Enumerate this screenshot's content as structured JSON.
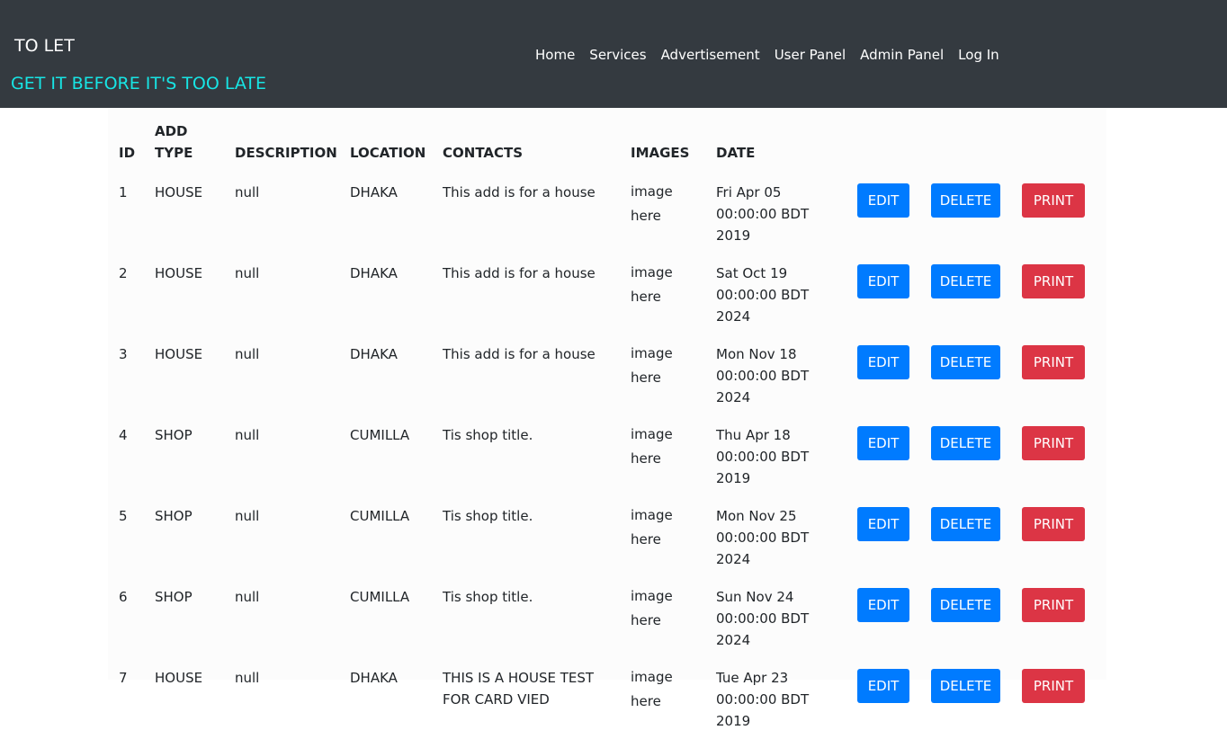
{
  "navbar": {
    "brand": "TO LET",
    "tagline": "GET IT BEFORE IT'S TOO LATE",
    "links": [
      "Home",
      "Services",
      "Advertisement",
      "User Panel",
      "Admin Panel",
      "Log In"
    ]
  },
  "table": {
    "headers": [
      "ID",
      "ADD TYPE",
      "DESCRIPTION",
      "LOCATION",
      "CONTACTS",
      "IMAGES",
      "DATE"
    ],
    "actions": {
      "edit": "EDIT",
      "delete": "DELETE",
      "print": "PRINT"
    },
    "rows": [
      {
        "id": "1",
        "type": "HOUSE",
        "description": "null",
        "location": "DHAKA",
        "contacts": "This add is for a house",
        "images": "image here",
        "date": "Fri Apr 05 00:00:00 BDT 2019"
      },
      {
        "id": "2",
        "type": "HOUSE",
        "description": "null",
        "location": "DHAKA",
        "contacts": "This add is for a house",
        "images": "image here",
        "date": "Sat Oct 19 00:00:00 BDT 2024"
      },
      {
        "id": "3",
        "type": "HOUSE",
        "description": "null",
        "location": "DHAKA",
        "contacts": "This add is for a house",
        "images": "image here",
        "date": "Mon Nov 18 00:00:00 BDT 2024"
      },
      {
        "id": "4",
        "type": "SHOP",
        "description": "null",
        "location": "CUMILLA",
        "contacts": "Tis shop title.",
        "images": "image here",
        "date": "Thu Apr 18 00:00:00 BDT 2019"
      },
      {
        "id": "5",
        "type": "SHOP",
        "description": "null",
        "location": "CUMILLA",
        "contacts": "Tis shop title.",
        "images": "image here",
        "date": "Mon Nov 25 00:00:00 BDT 2024"
      },
      {
        "id": "6",
        "type": "SHOP",
        "description": "null",
        "location": "CUMILLA",
        "contacts": "Tis shop title.",
        "images": "image here",
        "date": "Sun Nov 24 00:00:00 BDT 2024"
      },
      {
        "id": "7",
        "type": "HOUSE",
        "description": "null",
        "location": "DHAKA",
        "contacts": "THIS IS A HOUSE TEST FOR CARD VIED",
        "images": "image here",
        "date": "Tue Apr 23 00:00:00 BDT 2019"
      }
    ]
  }
}
